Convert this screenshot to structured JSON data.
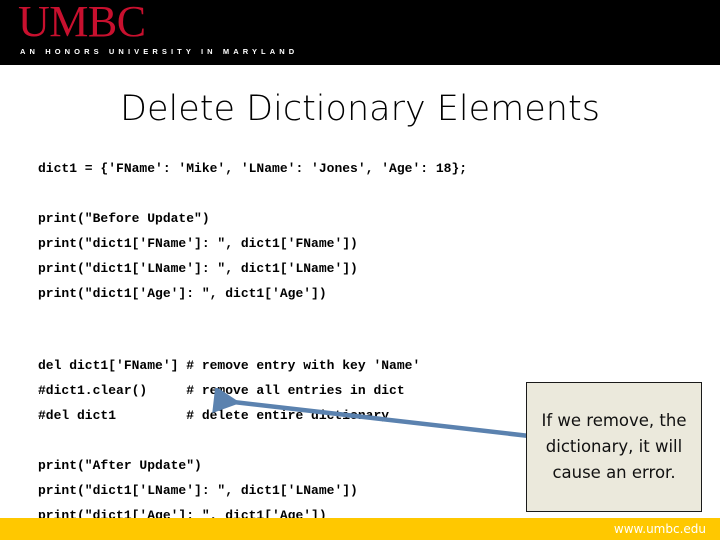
{
  "header": {
    "wordmark": "UMBC",
    "tagline": "AN HONORS UNIVERSITY IN MARYLAND",
    "logo_color": "#C8102E",
    "bar_color": "#000000"
  },
  "slide": {
    "title": "Delete Dictionary Elements"
  },
  "code": {
    "lines": [
      "dict1 = {'FName': 'Mike', 'LName': 'Jones', 'Age': 18};",
      "",
      "print(\"Before Update\")",
      "print(\"dict1['FName']: \", dict1['FName'])",
      "print(\"dict1['LName']: \", dict1['LName'])",
      "print(\"dict1['Age']: \", dict1['Age'])",
      "",
      "",
      "del dict1['FName'] # remove entry with key 'Name'",
      "#dict1.clear()     # remove all entries in dict",
      "#del dict1         # delete entire dictionary",
      "",
      "print(\"After Update\")",
      "print(\"dict1['LName']: \", dict1['LName'])",
      "print(\"dict1['Age']: \", dict1['Age'])"
    ]
  },
  "callout": {
    "text": "If we remove, the dictionary, it will cause an error.",
    "background": "#EBE9DC",
    "border_color": "#1a1a1a",
    "arrow_color": "#5B82AF"
  },
  "footer": {
    "url": "www.umbc.edu",
    "bar_color": "#FFC800"
  }
}
